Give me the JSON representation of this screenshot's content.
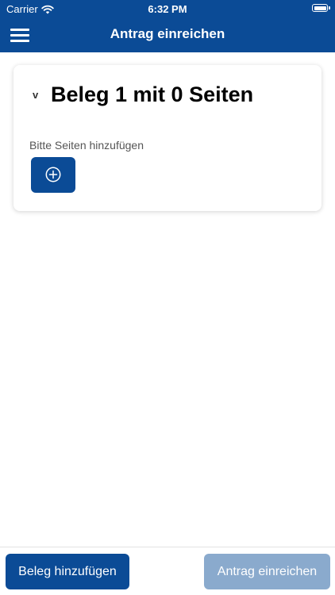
{
  "status_bar": {
    "carrier": "Carrier",
    "time": "6:32 PM"
  },
  "header": {
    "title": "Antrag einreichen"
  },
  "card": {
    "chevron": "v",
    "title": "Beleg 1 mit 0 Seiten",
    "hint": "Bitte Seiten hinzufügen"
  },
  "footer": {
    "add_label": "Beleg hinzufügen",
    "submit_label": "Antrag einreichen"
  },
  "colors": {
    "primary": "#0b4b96",
    "disabled": "#8aaacd"
  }
}
